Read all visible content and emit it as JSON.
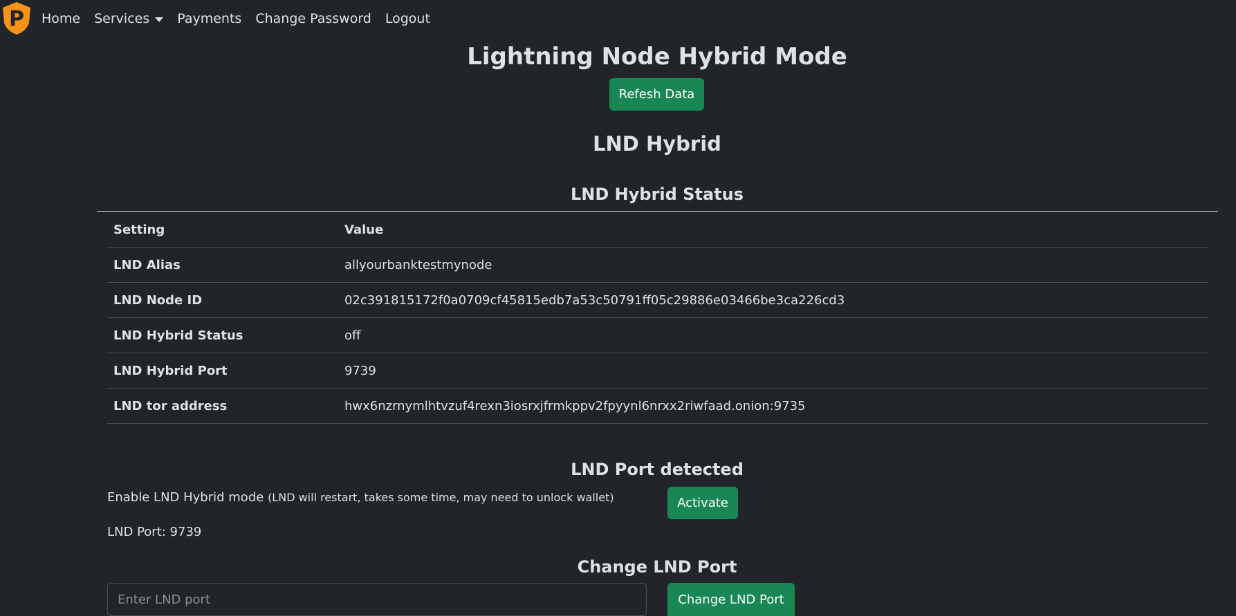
{
  "navbar": {
    "logo_letter": "P",
    "items": [
      {
        "label": "Home"
      },
      {
        "label": "Services"
      },
      {
        "label": "Payments"
      },
      {
        "label": "Change Password"
      },
      {
        "label": "Logout"
      }
    ]
  },
  "page": {
    "title": "Lightning Node Hybrid Mode",
    "refresh_button": "Refesh Data",
    "section_title": "LND Hybrid",
    "status_title": "LND Hybrid Status"
  },
  "table": {
    "headers": [
      "Setting",
      "Value"
    ],
    "rows": [
      {
        "setting": "LND Alias",
        "value": "allyourbanktestmynode"
      },
      {
        "setting": "LND Node ID",
        "value": "02c391815172f0a0709cf45815edb7a53c50791ff05c29886e03466be3ca226cd3"
      },
      {
        "setting": "LND Hybrid Status",
        "value": "off"
      },
      {
        "setting": "LND Hybrid Port",
        "value": "9739"
      },
      {
        "setting": "LND tor address",
        "value": "hwx6nzrnymlhtvzuf4rexn3iosrxjfrmkppv2fpyynl6nrxx2riwfaad.onion:9735"
      }
    ]
  },
  "port_detected": {
    "title": "LND Port detected",
    "enable_label": "Enable LND Hybrid mode",
    "enable_note": "(LND will restart, takes some time, may need to unlock wallet)",
    "activate_button": "Activate",
    "port_line": "LND Port: 9739"
  },
  "change_port": {
    "title": "Change LND Port",
    "input_placeholder": "Enter LND port",
    "input_value": "",
    "button": "Change LND Port"
  },
  "colors": {
    "background": "#212529",
    "accent_green": "#198754",
    "logo_orange": "#f7931a"
  }
}
